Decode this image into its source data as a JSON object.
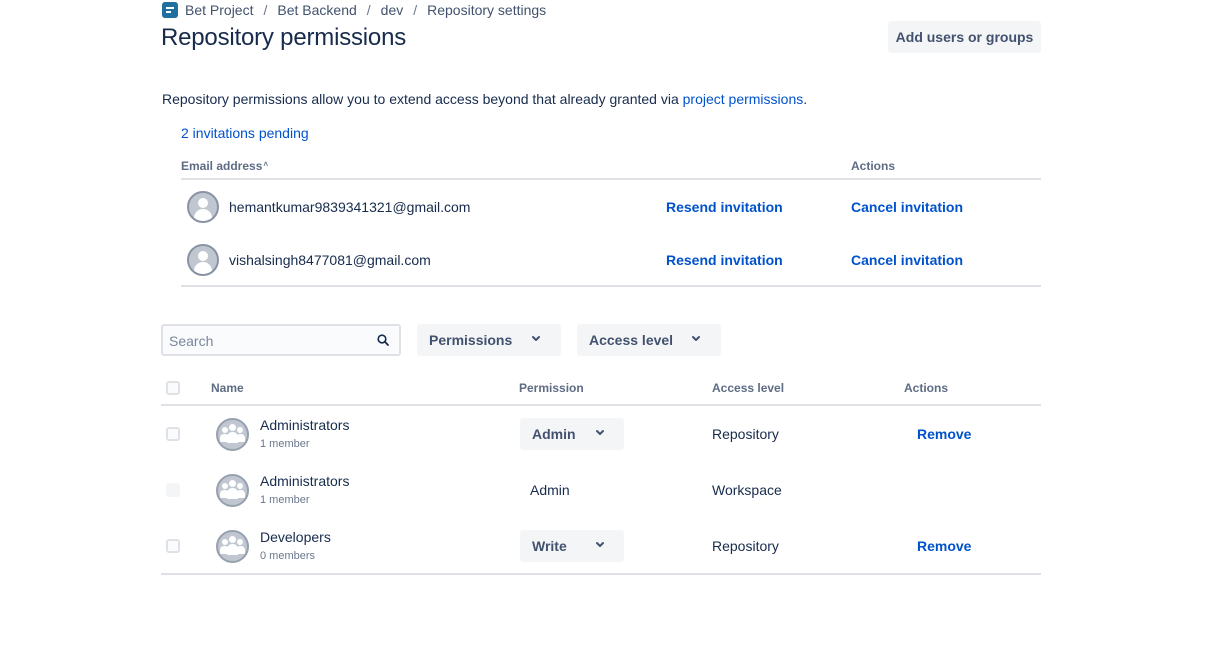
{
  "breadcrumb": {
    "items": [
      "Bet Project",
      "Bet Backend",
      "dev",
      "Repository settings"
    ],
    "separator": "/"
  },
  "page": {
    "title": "Repository permissions",
    "add_button": "Add users or groups",
    "description_prefix": "Repository permissions allow you to extend access beyond that already granted via ",
    "description_link": "project permissions",
    "description_suffix": "."
  },
  "invitations": {
    "pending_label": "2 invitations pending",
    "headers": {
      "email": "Email address",
      "sort_indicator": "˄",
      "actions": "Actions"
    },
    "rows": [
      {
        "email": "hemantkumar9839341321@gmail.com",
        "resend": "Resend invitation",
        "cancel": "Cancel invitation"
      },
      {
        "email": "vishalsingh8477081@gmail.com",
        "resend": "Resend invitation",
        "cancel": "Cancel invitation"
      }
    ]
  },
  "filters": {
    "search_placeholder": "Search",
    "permissions_label": "Permissions",
    "access_level_label": "Access level"
  },
  "permissions_table": {
    "headers": {
      "name": "Name",
      "permission": "Permission",
      "access_level": "Access level",
      "actions": "Actions"
    },
    "rows": [
      {
        "name": "Administrators",
        "members": "1 member",
        "permission": "Admin",
        "access_level": "Repository",
        "action": "Remove",
        "editable": true
      },
      {
        "name": "Administrators",
        "members": "1 member",
        "permission": "Admin",
        "access_level": "Workspace",
        "action": "",
        "editable": false
      },
      {
        "name": "Developers",
        "members": "0 members",
        "permission": "Write",
        "access_level": "Repository",
        "action": "Remove",
        "editable": true
      }
    ]
  },
  "colors": {
    "link": "#0052cc",
    "text": "#172b4d",
    "subtle_text": "#5e6c84",
    "button_bg": "#f4f5f7",
    "divider": "#dfe1e6",
    "logo": "#1f6f9f"
  },
  "icons": {
    "logo": "bitbucket-repo-icon",
    "search": "search-icon",
    "dropdown": "chevron-down-icon",
    "user_avatar": "user-avatar-icon",
    "group_avatar": "group-avatar-icon"
  }
}
